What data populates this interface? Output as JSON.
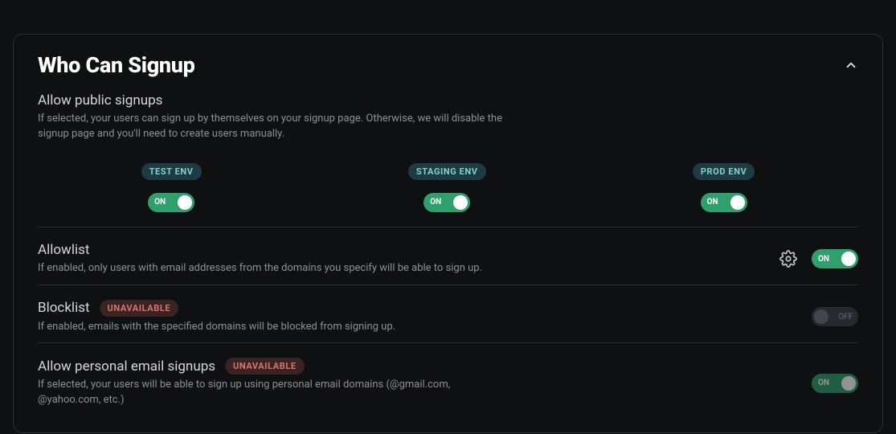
{
  "section": {
    "title": "Who Can Signup"
  },
  "public_signups": {
    "title": "Allow public signups",
    "desc": "If selected, your users can sign up by themselves on your signup page. Otherwise, we will disable the signup page and you'll need to create users manually."
  },
  "envs": [
    {
      "label": "TEST ENV",
      "state": "ON"
    },
    {
      "label": "STAGING ENV",
      "state": "ON"
    },
    {
      "label": "PROD ENV",
      "state": "ON"
    }
  ],
  "allowlist": {
    "title": "Allowlist",
    "desc": "If enabled, only users with email addresses from the domains you specify will be able to sign up.",
    "state": "ON"
  },
  "blocklist": {
    "title": "Blocklist",
    "badge": "UNAVAILABLE",
    "desc": "If enabled, emails with the specified domains will be blocked from signing up.",
    "state": "OFF"
  },
  "personal": {
    "title": "Allow personal email signups",
    "badge": "UNAVAILABLE",
    "desc": "If selected, your users will be able to sign up using personal email domains (@gmail.com, @yahoo.com, etc.)",
    "state": "ON"
  }
}
